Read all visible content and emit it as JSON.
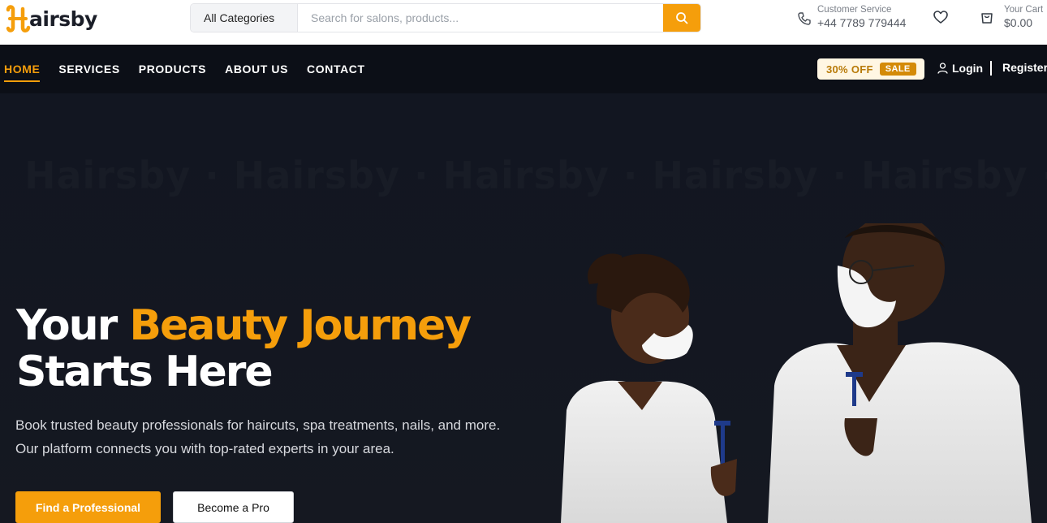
{
  "brand": {
    "logo_text": "airsby",
    "accent_color": "#f59e0b"
  },
  "search": {
    "category": "All Categories",
    "placeholder": "Search for salons, products...",
    "value": ""
  },
  "customer_service": {
    "label": "Customer Service",
    "phone": "+44 7789 779444"
  },
  "cart": {
    "label": "Your Cart",
    "amount": "$0.00"
  },
  "nav": {
    "items": [
      {
        "label": "HOME",
        "active": true
      },
      {
        "label": "SERVICES"
      },
      {
        "label": "PRODUCTS"
      },
      {
        "label": "ABOUT US"
      },
      {
        "label": "CONTACT"
      }
    ]
  },
  "promo": {
    "text": "30% OFF",
    "badge": "SALE"
  },
  "auth": {
    "login": "Login",
    "register": "Register"
  },
  "hero": {
    "watermark": "Hairsby · Hairsby · Hairsby · Hairsby · Hairsby · Hairsby",
    "title_line1_plain": "Your ",
    "title_line1_accent": "Beauty Journey",
    "title_line2": "Starts Here",
    "description": "Book trusted beauty professionals for haircuts, spa treatments, nails, and more. Our platform connects you with top-rated experts in your area.",
    "primary_button": "Find a Professional",
    "secondary_button": "Become a Pro"
  },
  "icons": [
    "phone-icon",
    "heart-icon",
    "cart-icon",
    "search-icon",
    "user-icon"
  ]
}
